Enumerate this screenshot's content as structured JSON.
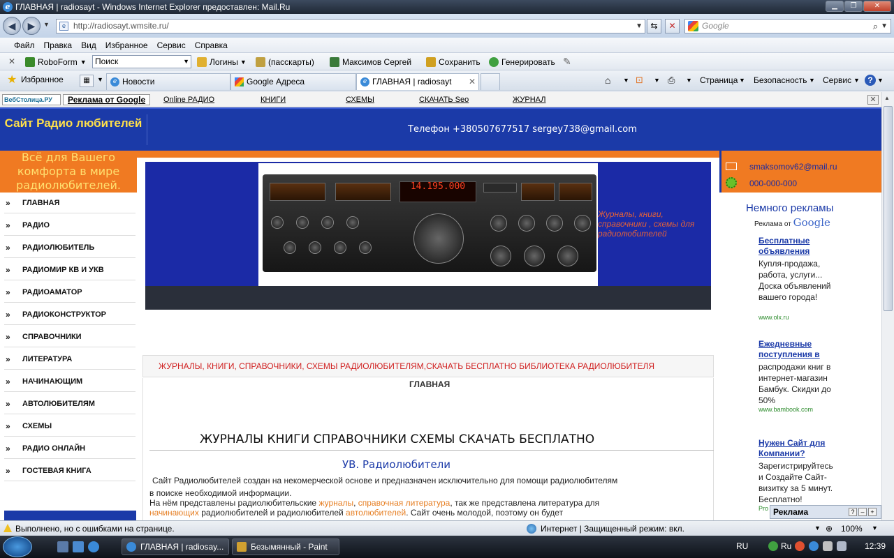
{
  "window": {
    "title": "ГЛАВНАЯ | radiosayt - Windows Internet Explorer предоставлен: Mail.Ru"
  },
  "addressbar": {
    "url": "http://radiosayt.wmsite.ru/",
    "search_placeholder": "Google"
  },
  "menu": [
    "Файл",
    "Правка",
    "Вид",
    "Избранное",
    "Сервис",
    "Справка"
  ],
  "roboform": {
    "name": "RoboForm",
    "search": "Поиск",
    "logins": "Логины",
    "passcards": "(пасскарты)",
    "user": "Максимов Сергей",
    "save": "Сохранить",
    "generate": "Генерировать"
  },
  "favorites": {
    "label": "Избранное",
    "tabs": [
      "Новости",
      "Google Адреса",
      "ГЛАВНАЯ | radiosayt"
    ],
    "commands": [
      "Страница",
      "Безопасность",
      "Сервис"
    ]
  },
  "site": {
    "topnav": {
      "logo": "ВебСтолица.РУ",
      "ad": "Реклама от Google",
      "links": [
        "Online РАДИО",
        "КНИГИ",
        "СХЕМЫ",
        "СКАЧАТЬ Seo",
        "ЖУРНАЛ"
      ]
    },
    "name": "Сайт Радио любителей",
    "contact": "Телефон +380507677517  sergey738@gmail.com",
    "slogan": "Всё для Вашего комфорта в мире радиолюбителей.",
    "right_contact": {
      "email": "smaksomov62@mail.ru",
      "phone": "000-000-000"
    },
    "nav": [
      "ГЛАВНАЯ",
      "РАДИО",
      "РАДИОЛЮБИТЕЛЬ",
      "РАДИОМИР КВ И УКВ",
      "РАДИОАМАТОР",
      "РАДИОКОНСТРУКТОР",
      "СПРАВОЧНИКИ",
      "ЛИТЕРАТУРА",
      "НАЧИНАЮЩИМ",
      "АВТОЛЮБИТЕЛЯМ",
      "СХЕМЫ",
      "РАДИО ОНЛАЙН",
      "ГОСТЕВАЯ КНИГА"
    ],
    "banner_text": "Журналы, книги, справочники , схемы для радиолюбителей",
    "radio_display": "14.195.000",
    "page_title": "ЖУРНАЛЫ, КНИГИ, СПРАВОЧНИКИ, СХЕМЫ РАДИОЛЮБИТЕЛЯМ,СКАЧАТЬ БЕСПЛАТНО БИБЛИОТЕКА РАДИОЛЮБИТЕЛЯ",
    "breadcrumb": "ГЛАВНАЯ",
    "h1": "ЖУРНАЛЫ КНИГИ СПРАВОЧНИКИ СХЕМЫ СКАЧАТЬ БЕСПЛАТНО",
    "h2": "УВ. Радиолюбители",
    "p1": "Сайт Радиолюбителей создан на некомерческой основе и предназначен исключительно для помощи радиолюбителям",
    "p1b": "в поиске необходимой информации.",
    "p2a": "На нём представлены радиолюбительские ",
    "p2_link1": "журналы",
    "p2b": ", ",
    "p2_link2": "справочная литература",
    "p2c": ", так же представлена литература для",
    "p3_link1": "начинающих",
    "p3a": " радиолюбителей и радиолюбителей ",
    "p3_link2": "автолюбителей",
    "p3b": ". Сайт очень молодой, поэтому он будет",
    "right_title": "Немного рекламы",
    "ads_label": "Реклама от",
    "ads_brand": "Google",
    "ads": [
      {
        "title": "Бесплатные объявления",
        "desc": "Купля-продажа, работа, услуги... Доска объявлений вашего города!",
        "url": "www.olx.ru"
      },
      {
        "title": "Ежедневные поступления в",
        "desc": "распродажи книг в интернет-магазин Бамбук. Скидки до 50%",
        "url": "www.bambook.com"
      },
      {
        "title": "Нужен Сайт для Компании?",
        "desc": "Зарегистрируйтесь и Создайте Сайт-визитку за 5 минут. Бесплатно!",
        "url": "Pro"
      }
    ],
    "reklama_widget": "Реклама"
  },
  "status": {
    "text": "Выполнено, но с ошибками на странице.",
    "zone": "Интернет | Защищенный режим: вкл.",
    "zoom": "100%"
  },
  "taskbar": {
    "items": [
      "ГЛАВНАЯ | radiosay...",
      "Безымянный - Paint"
    ],
    "lang": "RU",
    "lang2": "Ru",
    "time": "12:39"
  }
}
